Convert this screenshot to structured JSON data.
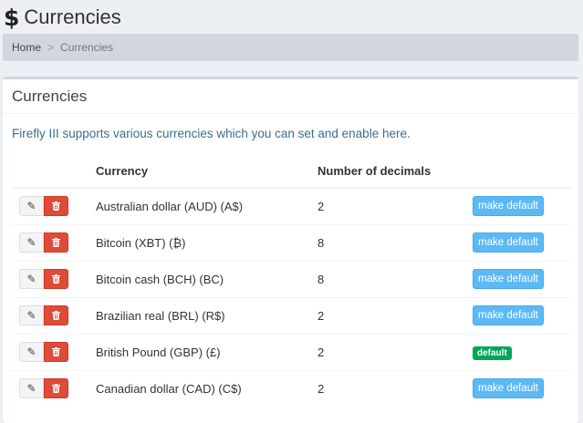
{
  "header": {
    "icon": "dollar-icon",
    "icon_glyph": "$",
    "title": "Currencies"
  },
  "breadcrumb": {
    "home": "Home",
    "separator": ">",
    "current": "Currencies"
  },
  "box": {
    "title": "Currencies",
    "intro": "Firefly III supports various currencies which you can set and enable here."
  },
  "table": {
    "columns": {
      "currency": "Currency",
      "decimals": "Number of decimals"
    },
    "rows": [
      {
        "name": "Australian dollar (AUD) (A$)",
        "decimals": "2",
        "action": "make default",
        "is_default": false
      },
      {
        "name": "Bitcoin (XBT) (₿)",
        "decimals": "8",
        "action": "make default",
        "is_default": false
      },
      {
        "name": "Bitcoin cash (BCH) (BC)",
        "decimals": "8",
        "action": "make default",
        "is_default": false
      },
      {
        "name": "Brazilian real (BRL) (R$)",
        "decimals": "2",
        "action": "make default",
        "is_default": false
      },
      {
        "name": "British Pound (GBP) (£)",
        "decimals": "2",
        "action": "default",
        "is_default": true
      },
      {
        "name": "Canadian dollar (CAD) (C$)",
        "decimals": "2",
        "action": "make default",
        "is_default": false
      }
    ]
  },
  "colors": {
    "primary": "#5cb9f5",
    "danger": "#dd4b39",
    "success": "#00a65a",
    "breadcrumb_bg": "#d2d6de",
    "intro_text": "#3c6d8f"
  }
}
